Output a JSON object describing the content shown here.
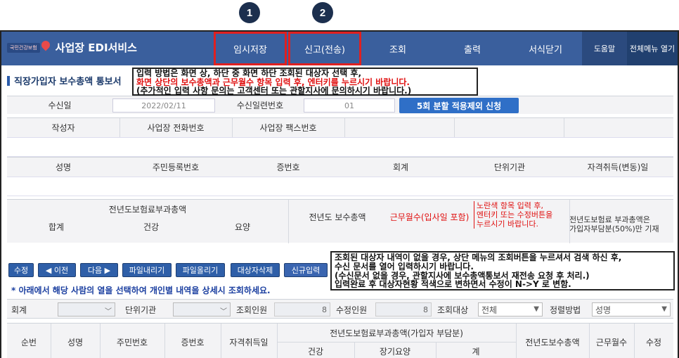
{
  "badges": [
    "1",
    "2"
  ],
  "app": {
    "logo_text": "국민건강보험",
    "title": "사업장 EDI서비스"
  },
  "menu": {
    "temp_save": "임시저장",
    "report": "신고(전송)",
    "inquiry": "조회",
    "print": "출력",
    "close_form": "서식닫기",
    "help": "도움말",
    "all_menu": "전체메뉴 열기"
  },
  "page": {
    "title": "직장가입자 보수총액 통보서",
    "notice": {
      "line1": "입력 방법은 화면 상, 하단 중 화면 하단 조회된 대상자 선택 후,",
      "line2": "화면 상단의 보수총액과 근무월수 항목 입력 후, 엔터키를 누르시기 바랍니다.",
      "line3": "(추가적인 입력 사항 문의는 고객센터 또는 관할지사에 문의하시기 바랍니다.)"
    }
  },
  "info": {
    "recv_date_label": "수신일",
    "recv_date_value": "2022/02/11",
    "recv_serial_label": "수신일련번호",
    "recv_serial_value": "01",
    "split_btn": "5회 분할 적용제외 신청",
    "author_label": "작성자",
    "phone_label": "사업장 전화번호",
    "fax_label": "사업장 팩스번호",
    "name_label": "성명",
    "rrn_label": "주민등록번호",
    "cert_label": "증번호",
    "account_label": "회계",
    "unit_label": "단위기관",
    "qual_label": "자격취득(변동)일"
  },
  "wage": {
    "prev_premium_label": "전년도보험료부과총액",
    "total_label": "합계",
    "health_label": "건강",
    "care_label": "요양",
    "prev_total_label": "전년도 보수총액",
    "months_label": "근무월수(입사일 포함)",
    "yellow_hint": {
      "l1": "노란색 항목 입력 후,",
      "l2": "엔터키 또는 수정버튼을",
      "l3": "누르시기 바랍니다."
    },
    "note": {
      "l1": "전년도보험료 부과총액은",
      "l2": "가입자부담분(50%)만 기재"
    }
  },
  "toolbar": {
    "edit": "수정",
    "prev": "◀ 이전",
    "next": "다음 ▶",
    "download": "파일내리기",
    "upload": "파일올리기",
    "delete_target": "대상자삭제",
    "new_input": "신규입력",
    "hint": "* 아래에서 해당 사람의 열을 선택하여 개인별 내역을 상세시 조회하세요."
  },
  "notice2": {
    "l1": "조회된 대상자 내역이 없을 경우, 상단 메뉴의 조회버튼을 누르셔서 검색 하신 후,",
    "l2": "수신 문서를 열어 입력하시기 바랍니다.",
    "l3": "(수신문서 없을 경우, 관할지사에 보수총액통보서 재전송 요청 후 처리.)",
    "l4": "입력완료 후 대상자현황 적색으로 변하면서 수정이 N->Y 로 변함."
  },
  "filter": {
    "account_label": "회계",
    "unit_label": "단위기관",
    "inquiry_count_label": "조회인원",
    "inquiry_count_value": "8",
    "edit_count_label": "수정인원",
    "edit_count_value": "8",
    "target_label": "조회대상",
    "target_value": "전체",
    "sort_label": "정렬방법",
    "sort_value": "성명"
  },
  "table": {
    "headers": {
      "seq": "순번",
      "name": "성명",
      "rrn": "주민번호",
      "cert": "증번호",
      "qual": "자격취득일",
      "premium_group": "전년도보험료부과총액(가입자 부담분)",
      "health": "건강",
      "care": "장기요양",
      "sum": "계",
      "prev_total": "전년도보수총액",
      "months": "근무월수",
      "edit": "수정"
    }
  }
}
